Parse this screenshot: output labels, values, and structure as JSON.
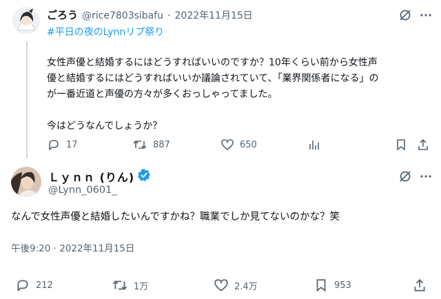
{
  "post1": {
    "display_name": "ごろう",
    "handle": "@rice7803sibafu",
    "separator": "·",
    "date": "2022年11月15日",
    "hashtag": "#平日の夜のLynnリプ祭り",
    "body": "女性声優と結婚するにはどうすればいいのですか？10年くらい前から女性声\n優と結婚するにはどうすればいいか議論されていて、「業界関係者になる」の\nが一番近道と声優の方々が多くおっしゃってました。\n\n今はどうなんでしょうか？",
    "replies": "17",
    "reposts": "887",
    "likes": "650"
  },
  "post2": {
    "display_name": "Ｌｙｎｎ (りん)",
    "handle": "@Lynn_0601_",
    "body": "なんで女性声優と結婚したいんですかね？職業でしか見てないのかな？笑",
    "timestamp": "午後9:20 · 2022年11月15日",
    "replies": "212",
    "reposts": "1万",
    "likes": "2.4万",
    "bookmarks": "953"
  },
  "colors": {
    "accent": "#1d9bf0",
    "muted": "#536471",
    "text": "#0f1419",
    "verified": "#1d9bf0"
  }
}
